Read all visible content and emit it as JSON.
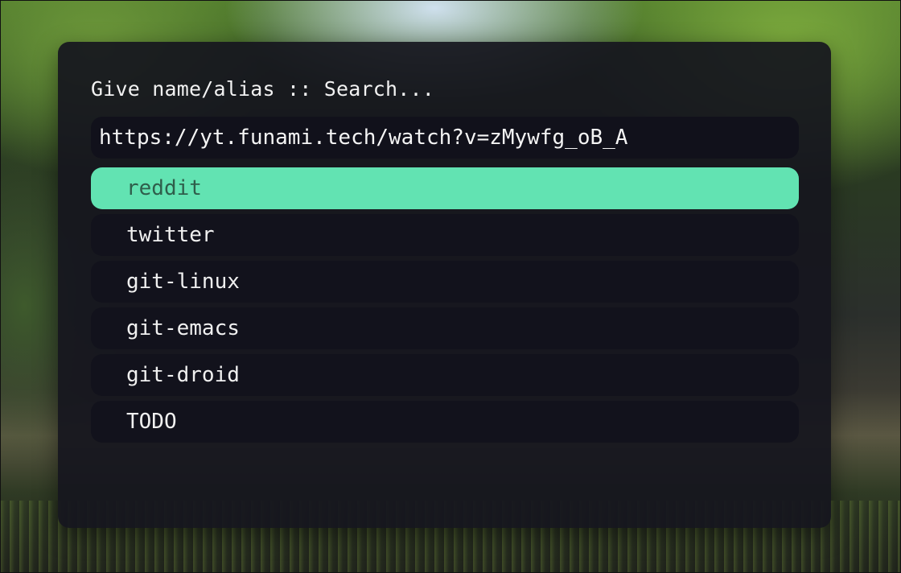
{
  "launcher": {
    "prompt": "Give name/alias :: Search...",
    "entry_value": "https://yt.funami.tech/watch?v=zMywfg_oB_A",
    "items": [
      {
        "label": "reddit",
        "selected": true
      },
      {
        "label": "twitter",
        "selected": false
      },
      {
        "label": "git-linux",
        "selected": false
      },
      {
        "label": "git-emacs",
        "selected": false
      },
      {
        "label": "git-droid",
        "selected": false
      },
      {
        "label": "TODO",
        "selected": false
      }
    ]
  },
  "colors": {
    "selected_bg": "#62e3b2",
    "selected_text": "#2f5e4b",
    "panel_bg": "#16161e",
    "item_bg": "#12121c"
  }
}
